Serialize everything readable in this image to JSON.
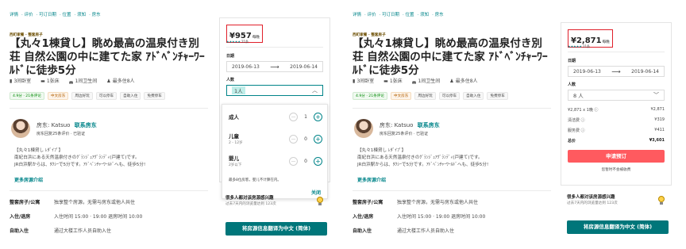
{
  "nav": [
    "详情",
    "评价",
    "可订日期",
    "位置",
    "须知",
    "房东"
  ],
  "listing": {
    "type": "西町家餐 · 整套房子",
    "title": "【丸々1棟貸し】眺め最高の温泉付き別荘 自然公園の中に建てた家 ｱﾄﾞﾍﾞﾝﾁｬｰﾜｰﾙﾄﾞに徒歩5分",
    "meta": [
      "3间卧室",
      "1张床",
      "1间卫生间",
      "最多住8人"
    ],
    "tags": [
      "4.9分 · 21条评论",
      "中文房东",
      "周边好玩",
      "可以停车",
      "自助入住",
      "免费停车"
    ]
  },
  "host": {
    "label": "房东:",
    "name": "Katsuo",
    "contact": "联系房东",
    "sub": "房东回复25条评价 · 已验证"
  },
  "description": {
    "lines": [
      "【丸々1棟貸し ﾚﾀﾞｲﾌﾟ】",
      "南紀白浜にある天然温泉付きのｸﾞﾗﾝｼﾞｭｱｸﾞﾗﾝﾃﾞｨ(戸建て)です。",
      "JR白浜駅からは、ﾀｸｼｰで5分です。ｱﾄﾞﾍﾞﾝﾁｬｰﾜｰﾙﾄﾞへも、徒歩5分!"
    ],
    "more": "更多房源介绍"
  },
  "details": [
    {
      "label": "整套房子/公寓",
      "value": "独享整个房源，无需与房东或他人共住"
    },
    {
      "label": "入住/退房",
      "value": "入住时间 15:00 · 19:00 退房时间 10:00"
    },
    {
      "label": "自助入住",
      "value": "通过大楼工作人员自助入住"
    }
  ],
  "left_card": {
    "price": "¥957",
    "per": "每晚",
    "stars": "★★★★★",
    "reviews": "21条",
    "date_label": "日期",
    "checkin": "2019-06-13",
    "checkout": "2019-06-14",
    "guests_label": "人数",
    "guests_value": "1人",
    "dropdown": {
      "adult": {
        "name": "成人",
        "count": "1"
      },
      "child": {
        "name": "儿童",
        "sub": "2 - 12岁",
        "count": "0"
      },
      "infant": {
        "name": "婴儿",
        "sub": "2岁以下",
        "count": "0"
      },
      "note": "最多8位房客，婴儿不计算在内。",
      "close": "关闭"
    }
  },
  "right_card": {
    "price": "¥2,871",
    "per": "每晚",
    "stars": "★★★★★",
    "reviews": "21条",
    "date_label": "日期",
    "checkin": "2019-06-13",
    "checkout": "2019-06-14",
    "guests_label": "人数",
    "guests_value": "8 人",
    "fees": [
      {
        "label": "¥2,871 x 1晚 ⓘ",
        "value": "¥2,871"
      },
      {
        "label": "清洁费 ⓘ",
        "value": "¥319"
      },
      {
        "label": "服务费 ⓘ",
        "value": "¥411"
      }
    ],
    "total_label": "总价",
    "total_value": "¥3,601",
    "book": "申请预订",
    "no_charge": "您暂时不会被收费"
  },
  "popular": {
    "title": "很多人都对该房源感兴趣",
    "sub": "过去7天内的浏览量达到 123次"
  },
  "translate": "将房源信息翻译为中文 (简体)",
  "colors": {
    "accent": "#008489",
    "book": "#ff5a5f",
    "price_border": "#e0202a",
    "translate": "#00767a"
  }
}
